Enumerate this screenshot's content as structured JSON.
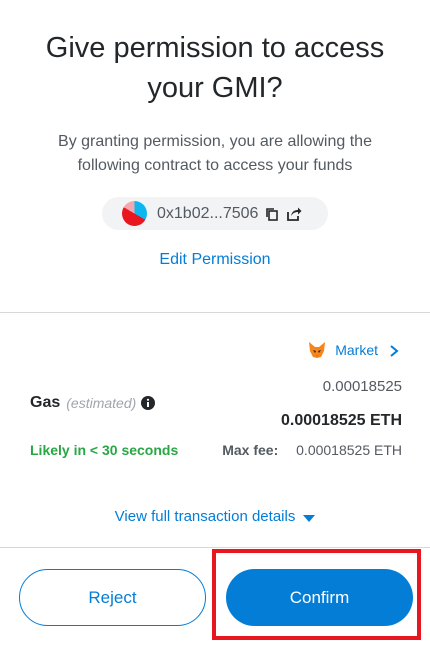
{
  "header": {
    "title": "Give permission to access your GMI?",
    "subtitle": "By granting permission, you are allowing the following contract to access your funds"
  },
  "contract": {
    "address": "0x1b02...7506",
    "identicon_colors": [
      "#0eb6f0",
      "#e8161f",
      "#f2a8b0"
    ]
  },
  "edit_permission_label": "Edit Permission",
  "gas": {
    "market_label": "Market",
    "amount_top": "0.00018525",
    "label": "Gas",
    "estimated": "(estimated)",
    "amount_main": "0.00018525 ETH",
    "likely": "Likely in < 30 seconds",
    "max_fee_label": "Max fee:",
    "max_fee_value": "0.00018525 ETH"
  },
  "view_details_label": "View full transaction details",
  "buttons": {
    "reject": "Reject",
    "confirm": "Confirm"
  },
  "colors": {
    "accent": "#037dd6",
    "success": "#28a745",
    "highlight": "#e8161f"
  }
}
